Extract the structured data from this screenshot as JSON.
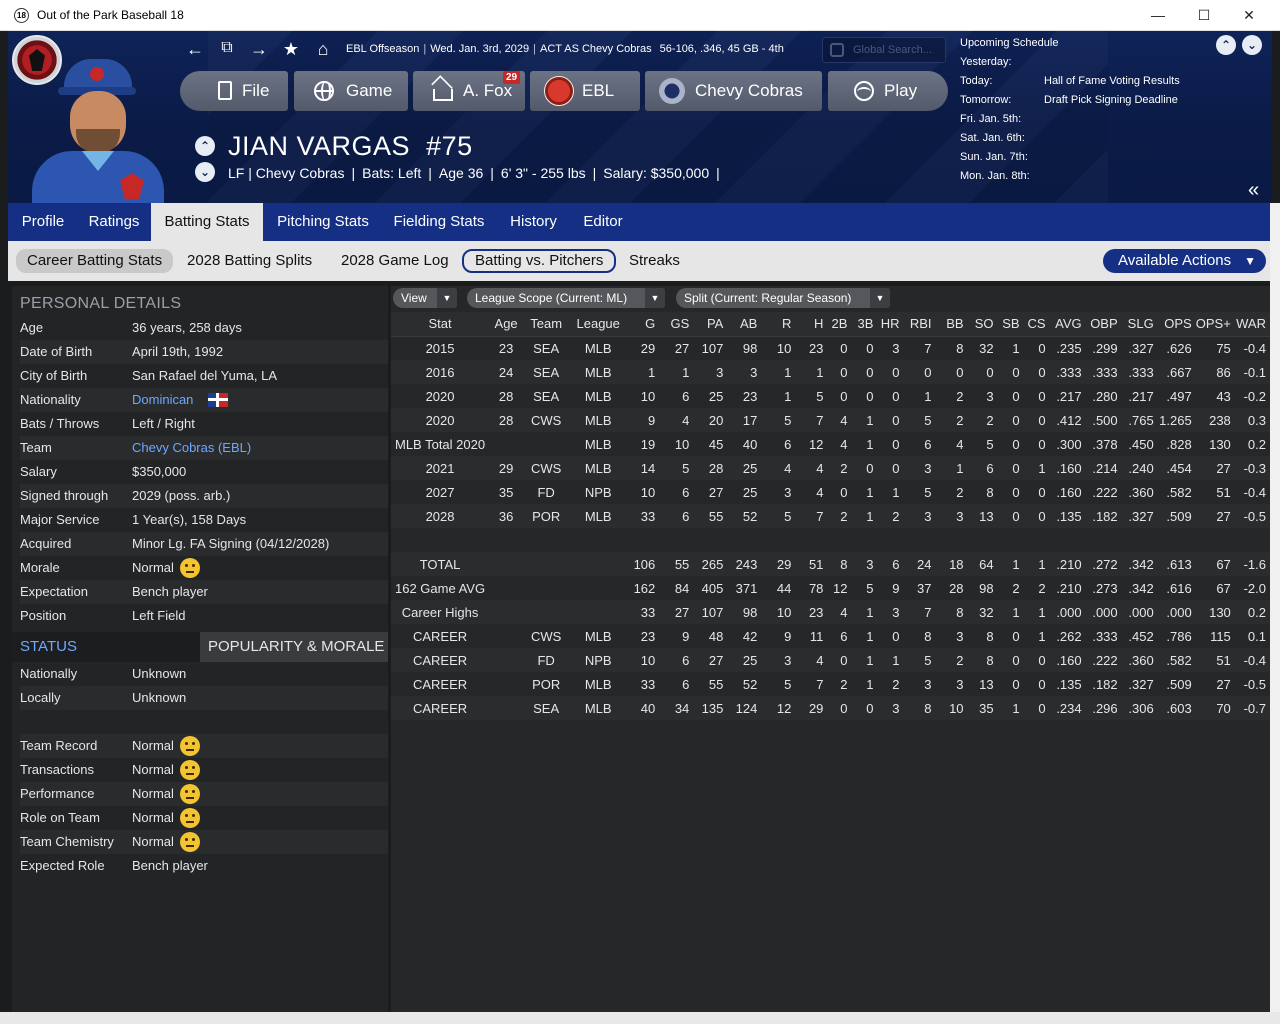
{
  "window": {
    "app_icon_text": "18",
    "title": "Out of the Park Baseball 18",
    "min_label": "—",
    "max_label": "☐",
    "close_label": "✕"
  },
  "header": {
    "context": {
      "league_state": "EBL Offseason",
      "date": "Wed. Jan. 3rd, 2029",
      "act_as": "ACT AS Chevy Cobras",
      "record": "56-106, .346, 45 GB - 4th"
    },
    "search_placeholder": "Global Search...",
    "nav": [
      {
        "label": "File",
        "icon": "file-icon"
      },
      {
        "label": "Game",
        "icon": "globe-icon"
      },
      {
        "label": "A. Fox",
        "icon": "home-icon",
        "badge": "29"
      },
      {
        "label": "EBL",
        "icon": "ebl-logo-icon"
      },
      {
        "label": "Chevy Cobras",
        "icon": "cobras-logo-icon"
      },
      {
        "label": "Play",
        "icon": "baseball-icon"
      }
    ],
    "player": {
      "name": "JIAN VARGAS",
      "number": "#75",
      "position_team": "LF | Chevy Cobras",
      "bats": "Bats: Left",
      "age": "Age 36",
      "size": "6' 3\" - 255 lbs",
      "salary": "Salary: $350,000",
      "trailing": "|"
    },
    "schedule": {
      "title": "Upcoming Schedule",
      "rows": [
        {
          "day": "Yesterday:",
          "event": ""
        },
        {
          "day": "Today:",
          "event": "Hall of Fame Voting Results"
        },
        {
          "day": "Tomorrow:",
          "event": "Draft Pick Signing Deadline"
        },
        {
          "day": "Fri. Jan. 5th:",
          "event": ""
        },
        {
          "day": "Sat. Jan. 6th:",
          "event": ""
        },
        {
          "day": "Sun. Jan. 7th:",
          "event": ""
        },
        {
          "day": "Mon. Jan. 8th:",
          "event": ""
        }
      ]
    }
  },
  "tabs": [
    "Profile",
    "Ratings",
    "Batting Stats",
    "Pitching Stats",
    "Fielding Stats",
    "History",
    "Editor"
  ],
  "active_tab": "Batting Stats",
  "subtabs": [
    "Career Batting Stats",
    "2028 Batting Splits",
    "2028 Game Log",
    "Batting vs. Pitchers",
    "Streaks"
  ],
  "available_actions": "Available Actions",
  "personal": {
    "title": "PERSONAL DETAILS",
    "rows": [
      {
        "k": "Age",
        "v": "36 years, 258 days"
      },
      {
        "k": "Date of Birth",
        "v": "April 19th, 1992"
      },
      {
        "k": "City of Birth",
        "v": "San Rafael del Yuma, LA"
      },
      {
        "k": "Nationality",
        "v": "Dominican"
      },
      {
        "k": "Bats / Throws",
        "v": "Left / Right"
      },
      {
        "k": "Team",
        "v": "Chevy Cobras (EBL)"
      },
      {
        "k": "Salary",
        "v": "$350,000"
      },
      {
        "k": "Signed through",
        "v": "2029 (poss. arb.)"
      },
      {
        "k": "Major Service",
        "v": "1 Year(s), 158 Days"
      },
      {
        "k": "Acquired",
        "v": "Minor Lg. FA Signing (04/12/2028)"
      },
      {
        "k": "Morale",
        "v": "Normal"
      },
      {
        "k": "Expectation",
        "v": "Bench player"
      },
      {
        "k": "Position",
        "v": "Left Field"
      }
    ]
  },
  "status": {
    "tab_status": "STATUS",
    "tab_popularity": "POPULARITY & MORALE",
    "rows": [
      {
        "k": "Nationally",
        "v": "Unknown"
      },
      {
        "k": "Locally",
        "v": "Unknown"
      }
    ],
    "morale_rows": [
      {
        "k": "Team Record",
        "v": "Normal"
      },
      {
        "k": "Transactions",
        "v": "Normal"
      },
      {
        "k": "Performance",
        "v": "Normal"
      },
      {
        "k": "Role on Team",
        "v": "Normal"
      },
      {
        "k": "Team Chemistry",
        "v": "Normal"
      },
      {
        "k": "Expected Role",
        "v": "Bench player"
      }
    ]
  },
  "filters": {
    "view": "View",
    "league_scope": "League Scope  (Current: ML)",
    "split": "Split  (Current: Regular Season)"
  },
  "table": {
    "columns": [
      "Stat",
      "Age",
      "Team",
      "League",
      "G",
      "GS",
      "PA",
      "AB",
      "R",
      "H",
      "2B",
      "3B",
      "HR",
      "RBI",
      "BB",
      "SO",
      "SB",
      "CS",
      "AVG",
      "OBP",
      "SLG",
      "OPS",
      "OPS+",
      "WAR"
    ],
    "rows": [
      [
        "2015",
        "23",
        "SEA",
        "MLB",
        "29",
        "27",
        "107",
        "98",
        "10",
        "23",
        "0",
        "0",
        "3",
        "7",
        "8",
        "32",
        "1",
        "0",
        ".235",
        ".299",
        ".327",
        ".626",
        "75",
        "-0.4"
      ],
      [
        "2016",
        "24",
        "SEA",
        "MLB",
        "1",
        "1",
        "3",
        "3",
        "1",
        "1",
        "0",
        "0",
        "0",
        "0",
        "0",
        "0",
        "0",
        "0",
        ".333",
        ".333",
        ".333",
        ".667",
        "86",
        "-0.1"
      ],
      [
        "2020",
        "28",
        "SEA",
        "MLB",
        "10",
        "6",
        "25",
        "23",
        "1",
        "5",
        "0",
        "0",
        "0",
        "1",
        "2",
        "3",
        "0",
        "0",
        ".217",
        ".280",
        ".217",
        ".497",
        "43",
        "-0.2"
      ],
      [
        "2020",
        "28",
        "CWS",
        "MLB",
        "9",
        "4",
        "20",
        "17",
        "5",
        "7",
        "4",
        "1",
        "0",
        "5",
        "2",
        "2",
        "0",
        "0",
        ".412",
        ".500",
        ".765",
        "1.265",
        "238",
        "0.3"
      ],
      [
        "MLB Total 2020",
        "",
        "",
        "MLB",
        "19",
        "10",
        "45",
        "40",
        "6",
        "12",
        "4",
        "1",
        "0",
        "6",
        "4",
        "5",
        "0",
        "0",
        ".300",
        ".378",
        ".450",
        ".828",
        "130",
        "0.2"
      ],
      [
        "2021",
        "29",
        "CWS",
        "MLB",
        "14",
        "5",
        "28",
        "25",
        "4",
        "4",
        "2",
        "0",
        "0",
        "3",
        "1",
        "6",
        "0",
        "1",
        ".160",
        ".214",
        ".240",
        ".454",
        "27",
        "-0.3"
      ],
      [
        "2027",
        "35",
        "FD",
        "NPB",
        "10",
        "6",
        "27",
        "25",
        "3",
        "4",
        "0",
        "1",
        "1",
        "5",
        "2",
        "8",
        "0",
        "0",
        ".160",
        ".222",
        ".360",
        ".582",
        "51",
        "-0.4"
      ],
      [
        "2028",
        "36",
        "POR",
        "MLB",
        "33",
        "6",
        "55",
        "52",
        "5",
        "7",
        "2",
        "1",
        "2",
        "3",
        "3",
        "13",
        "0",
        "0",
        ".135",
        ".182",
        ".327",
        ".509",
        "27",
        "-0.5"
      ],
      [
        "",
        "",
        "",
        "",
        "",
        "",
        "",
        "",
        "",
        "",
        "",
        "",
        "",
        "",
        "",
        "",
        "",
        "",
        "",
        "",
        "",
        "",
        "",
        ""
      ],
      [
        "TOTAL",
        "",
        "",
        "",
        "106",
        "55",
        "265",
        "243",
        "29",
        "51",
        "8",
        "3",
        "6",
        "24",
        "18",
        "64",
        "1",
        "1",
        ".210",
        ".272",
        ".342",
        ".613",
        "67",
        "-1.6"
      ],
      [
        "162 Game AVG",
        "",
        "",
        "",
        "162",
        "84",
        "405",
        "371",
        "44",
        "78",
        "12",
        "5",
        "9",
        "37",
        "28",
        "98",
        "2",
        "2",
        ".210",
        ".273",
        ".342",
        ".616",
        "67",
        "-2.0"
      ],
      [
        "Career Highs",
        "",
        "",
        "",
        "33",
        "27",
        "107",
        "98",
        "10",
        "23",
        "4",
        "1",
        "3",
        "7",
        "8",
        "32",
        "1",
        "1",
        ".000",
        ".000",
        ".000",
        ".000",
        "130",
        "0.2"
      ],
      [
        "CAREER",
        "",
        "CWS",
        "MLB",
        "23",
        "9",
        "48",
        "42",
        "9",
        "11",
        "6",
        "1",
        "0",
        "8",
        "3",
        "8",
        "0",
        "1",
        ".262",
        ".333",
        ".452",
        ".786",
        "115",
        "0.1"
      ],
      [
        "CAREER",
        "",
        "FD",
        "NPB",
        "10",
        "6",
        "27",
        "25",
        "3",
        "4",
        "0",
        "1",
        "1",
        "5",
        "2",
        "8",
        "0",
        "0",
        ".160",
        ".222",
        ".360",
        ".582",
        "51",
        "-0.4"
      ],
      [
        "CAREER",
        "",
        "POR",
        "MLB",
        "33",
        "6",
        "55",
        "52",
        "5",
        "7",
        "2",
        "1",
        "2",
        "3",
        "3",
        "13",
        "0",
        "0",
        ".135",
        ".182",
        ".327",
        ".509",
        "27",
        "-0.5"
      ],
      [
        "CAREER",
        "",
        "SEA",
        "MLB",
        "40",
        "34",
        "135",
        "124",
        "12",
        "29",
        "0",
        "0",
        "3",
        "8",
        "10",
        "35",
        "1",
        "0",
        ".234",
        ".296",
        ".306",
        ".603",
        "70",
        "-0.7"
      ]
    ]
  },
  "colors": {
    "header_navy": "#0b1b47",
    "tab_blue": "#142f84",
    "link_blue": "#6ea8ff",
    "panel_dark": "#232426"
  }
}
